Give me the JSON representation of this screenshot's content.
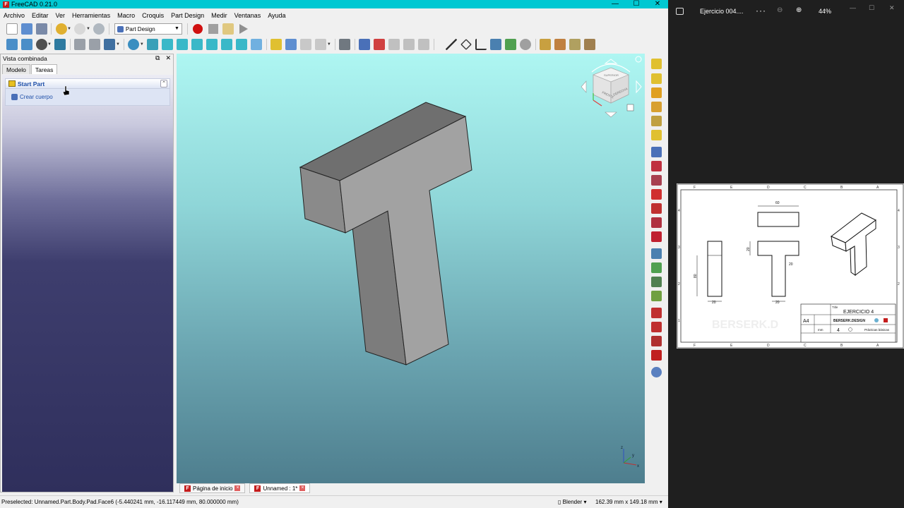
{
  "freecad": {
    "title": "FreeCAD 0.21.0",
    "menu": [
      "Archivo",
      "Editar",
      "Ver",
      "Herramientas",
      "Macro",
      "Croquis",
      "Part Design",
      "Medir",
      "Ventanas",
      "Ayuda"
    ],
    "workbench": "Part Design",
    "combo": {
      "header": "Vista combinada",
      "tabs": [
        "Modelo",
        "Tareas"
      ],
      "active_tab": "Tareas",
      "taskbox_title": "Start Part",
      "taskbox_action": "Crear cuerpo"
    },
    "doc_tabs": [
      {
        "label": "Página de inicio",
        "active": false
      },
      {
        "label": "Unnamed : 1*",
        "active": true
      }
    ],
    "status": {
      "message": "Preselected: Unnamed.Part.Body.Pad.Face6 (-5.440241 mm, -16.117449 mm, 80.000000 mm)",
      "navigation": "Blender",
      "dimensions": "162.39 mm x 149.18 mm"
    },
    "nav_cube": {
      "faces": [
        "FRENTE",
        "DERECHA",
        "SUPERIOR"
      ]
    },
    "axis": {
      "x": "x",
      "y": "y",
      "z": "z"
    }
  },
  "viewer": {
    "filename": "Ejercicio 004....",
    "more": "···",
    "zoom": "44%"
  },
  "drawing": {
    "col_letters_top": [
      "F",
      "E",
      "D",
      "C",
      "B",
      "A"
    ],
    "col_letters_bottom": [
      "F",
      "E",
      "D",
      "C",
      "B",
      "A"
    ],
    "row_numbers": [
      "4",
      "3",
      "2",
      "1"
    ],
    "dims": {
      "top_width": "60",
      "front_height": "80",
      "front_width": "20",
      "tee_flange": "20",
      "tee_web": "20",
      "tee_width": "20"
    },
    "title_label": "Title",
    "title": "EJERCICIO 4",
    "sheet_size": "A4",
    "scale_label": "mm",
    "sheet_number": "4",
    "brand": "BERSERK.DESIGN",
    "subject": "Prácticas básicas",
    "watermark": "BERSERK.D"
  },
  "colors": {
    "titlebar": "#00c8d2",
    "view_top": "#aef6f2",
    "view_bottom": "#4e7e8e",
    "model_face": "#a0a0a0",
    "model_top": "#6f6f6f",
    "model_side": "#808080"
  }
}
